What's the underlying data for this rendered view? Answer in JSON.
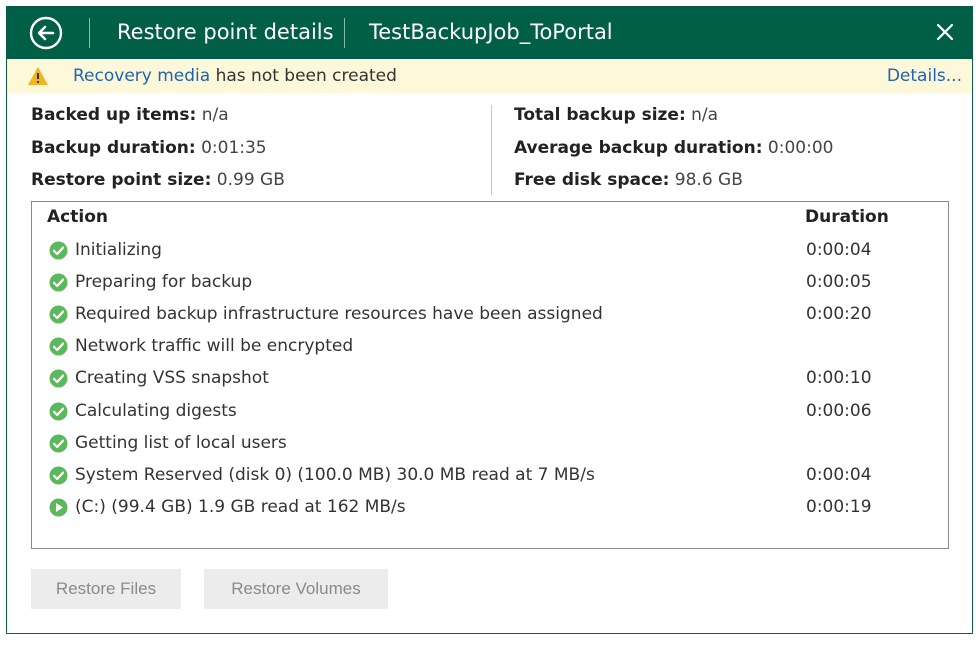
{
  "header": {
    "title": "Restore point details",
    "job_name": "TestBackupJob_ToPortal"
  },
  "warning": {
    "link_text": "Recovery media",
    "message_rest": " has not been created",
    "details_label": "Details..."
  },
  "stats": {
    "left": [
      {
        "label": "Backed up items:",
        "value": "n/a"
      },
      {
        "label": "Backup duration:",
        "value": "0:01:35"
      },
      {
        "label": "Restore point size:",
        "value": "0.99 GB"
      }
    ],
    "right": [
      {
        "label": "Total backup size:",
        "value": "n/a"
      },
      {
        "label": "Average backup duration:",
        "value": "0:00:00"
      },
      {
        "label": "Free disk space:",
        "value": "98.6 GB"
      }
    ]
  },
  "table": {
    "columns": {
      "action": "Action",
      "duration": "Duration"
    },
    "rows": [
      {
        "status": "success",
        "action": "Initializing",
        "duration": "0:00:04"
      },
      {
        "status": "success",
        "action": "Preparing for backup",
        "duration": "0:00:05"
      },
      {
        "status": "success",
        "action": "Required backup infrastructure resources have been assigned",
        "duration": "0:00:20"
      },
      {
        "status": "success",
        "action": "Network traffic will be encrypted",
        "duration": ""
      },
      {
        "status": "success",
        "action": "Creating VSS snapshot",
        "duration": "0:00:10"
      },
      {
        "status": "success",
        "action": "Calculating digests",
        "duration": "0:00:06"
      },
      {
        "status": "success",
        "action": "Getting list of local users",
        "duration": ""
      },
      {
        "status": "success",
        "action": "System Reserved (disk 0) (100.0 MB) 30.0 MB read at 7 MB/s",
        "duration": "0:00:04"
      },
      {
        "status": "running",
        "action": "(C:) (99.4 GB) 1.9 GB read at 162 MB/s",
        "duration": "0:00:19"
      }
    ]
  },
  "buttons": {
    "restore_files": "Restore Files",
    "restore_volumes": "Restore Volumes"
  },
  "colors": {
    "header_bg": "#005f46",
    "warning_bg": "#fcf8d9",
    "success_green": "#5cb85c",
    "link_blue": "#1f63b5"
  }
}
